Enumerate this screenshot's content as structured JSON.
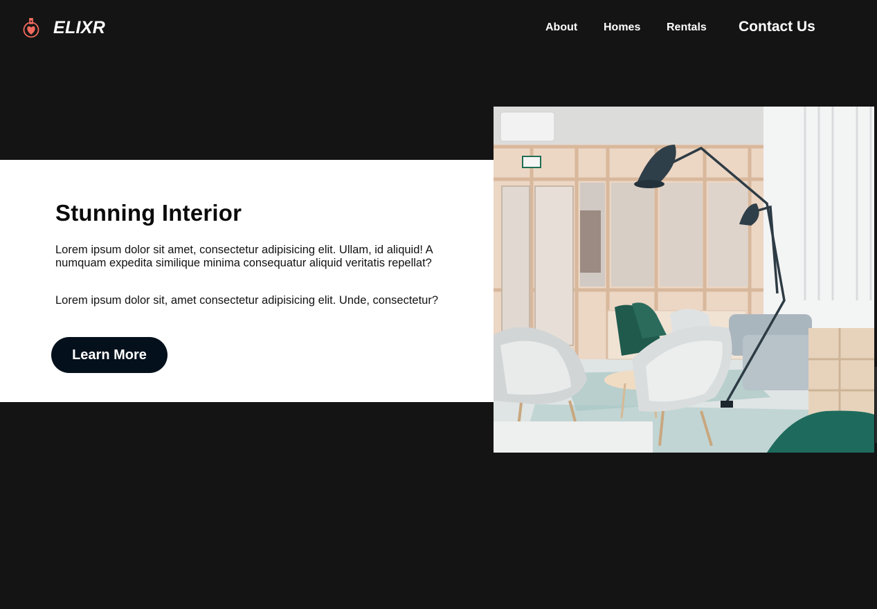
{
  "brand": {
    "name": "ELIXR",
    "icon": "potion-heart-icon",
    "icon_color": "#f06b5e"
  },
  "nav": {
    "about": "About",
    "homes": "Homes",
    "rentals": "Rentals",
    "contact": "Contact Us"
  },
  "hero": {
    "title": "Stunning Interior",
    "paragraph_1": "Lorem ipsum dolor sit amet, consectetur adipisicing elit. Ullam, id aliquid! A numquam expedita similique minima consequatur aliquid veritatis repellat?",
    "paragraph_2": "Lorem ipsum dolor sit, amet consectetur adipisicing elit. Unde, consectetur?",
    "button_label": "Learn More"
  },
  "colors": {
    "background": "#141414",
    "card": "#ffffff",
    "button": "#04101b",
    "text_light": "#ffffff",
    "text_dark": "#0b0b0b"
  }
}
